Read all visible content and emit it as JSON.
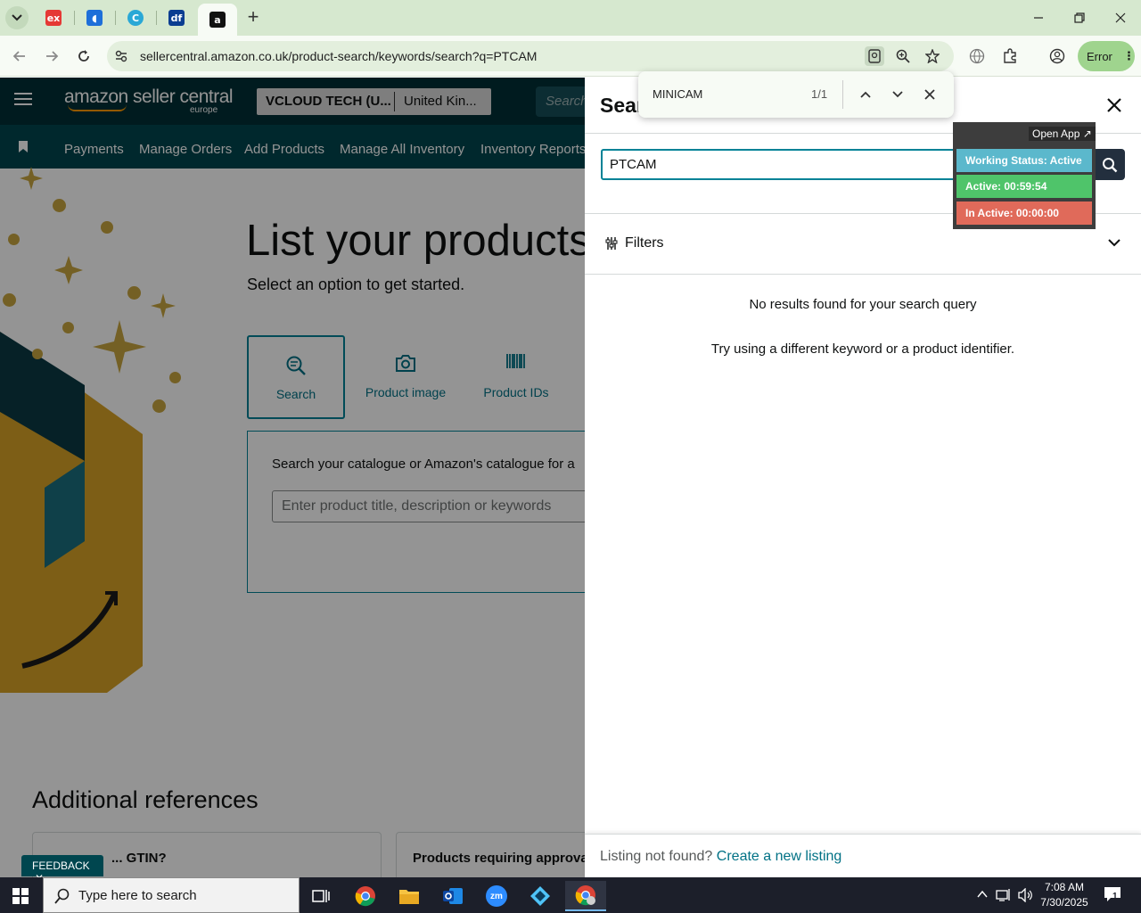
{
  "browser": {
    "tabs": [
      {
        "icon": "ex-favicon-icon",
        "glyph": "ex",
        "color": "#e53935"
      },
      {
        "icon": "blue-app-favicon-icon",
        "glyph": "◖",
        "color": "#1e6fd9"
      },
      {
        "icon": "c-favicon-icon",
        "glyph": "©",
        "color": "#2aa8d6"
      },
      {
        "icon": "df-favicon-icon",
        "glyph": "df",
        "color": "#0b3d91"
      },
      {
        "icon": "amazon-favicon-icon",
        "glyph": "a",
        "color": "#111111"
      }
    ],
    "url": "sellercentral.amazon.co.uk/product-search/keywords/search?q=PTCAM",
    "profile_status": "Error"
  },
  "find_bar": {
    "query": "MINICAM",
    "count": "1/1"
  },
  "seller_central": {
    "logo_text": "amazon seller central",
    "logo_sub": "europe",
    "account_name": "VCLOUD TECH (U...",
    "marketplace": "United Kin...",
    "header_search_placeholder": "Search",
    "nav": [
      "Payments",
      "Manage Orders",
      "Add Products",
      "Manage All Inventory",
      "Inventory Reports"
    ],
    "hero_title": "List your products",
    "hero_subtitle": "Select an option to get started.",
    "options": [
      {
        "label": "Search",
        "icon": "search-icon"
      },
      {
        "label": "Product image",
        "icon": "camera-icon"
      },
      {
        "label": "Product IDs",
        "icon": "barcode-icon"
      }
    ],
    "search_box_text": "Search your catalogue or Amazon's catalogue for a",
    "search_box_placeholder": "Enter product title, description or keywords",
    "additional_references": "Additional references",
    "ref_cards": [
      "... GTIN?",
      "Products requiring approva"
    ],
    "feedback": "FEEDBACK"
  },
  "panel": {
    "title": "Sear",
    "search_value": "PTCAM",
    "filters_label": "Filters",
    "no_results": "No results found for your search query",
    "try_text": "Try using a different keyword or a product identifier.",
    "footer_text": "Listing not found?",
    "footer_link": "Create a new listing"
  },
  "status_widget": {
    "open_app": "Open App ↗",
    "working_status": "Working Status: Active",
    "active": "Active: 00:59:54",
    "inactive": "In Active: 00:00:00",
    "colors": {
      "working": "#5bb8cc",
      "active": "#4fc46a",
      "inactive": "#e06a5a"
    }
  },
  "taskbar": {
    "search_placeholder": "Type here to search",
    "time": "7:08 AM",
    "date": "7/30/2025",
    "notification_count": "1"
  }
}
